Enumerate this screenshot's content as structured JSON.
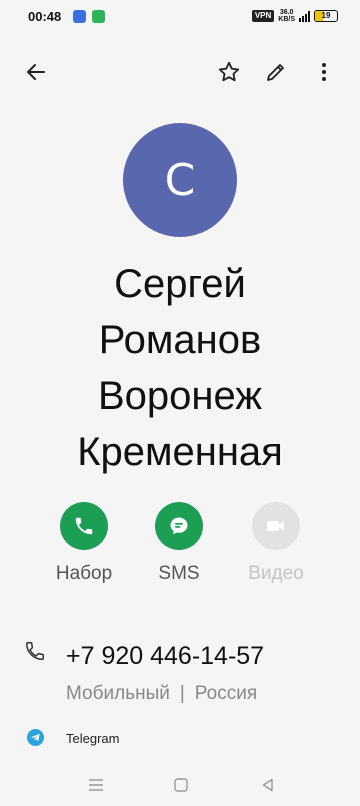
{
  "status_bar": {
    "time": "00:48",
    "vpn": "VPN",
    "net_speed_value": "36.0",
    "net_speed_unit": "KB/S",
    "battery": "19"
  },
  "toolbar": {
    "back_icon": "arrow-left-icon",
    "favorite_icon": "star-outline-icon",
    "edit_icon": "pencil-icon",
    "more_icon": "more-vertical-icon"
  },
  "contact": {
    "initial": "С",
    "avatar_color": "#5967ae",
    "name_lines": [
      "Сергей",
      "Романов",
      "Воронеж",
      "Кременная"
    ]
  },
  "actions": [
    {
      "label": "Набор",
      "icon": "phone-icon",
      "color": "#1d9e55",
      "enabled": true
    },
    {
      "label": "SMS",
      "icon": "message-icon",
      "color": "#1d9e55",
      "enabled": true
    },
    {
      "label": "Видео",
      "icon": "video-camera-icon",
      "color": "#e2e2e2",
      "enabled": false
    }
  ],
  "phone": {
    "number": "+7 920 446-14-57",
    "type": "Мобильный",
    "separator": "|",
    "region": "Россия"
  },
  "apps": [
    {
      "label": "Telegram",
      "icon": "telegram-icon",
      "color": "#2aa3df"
    }
  ],
  "navbar": {
    "menu_icon": "menu-icon",
    "home_icon": "home-square-icon",
    "back_icon": "back-triangle-icon"
  }
}
